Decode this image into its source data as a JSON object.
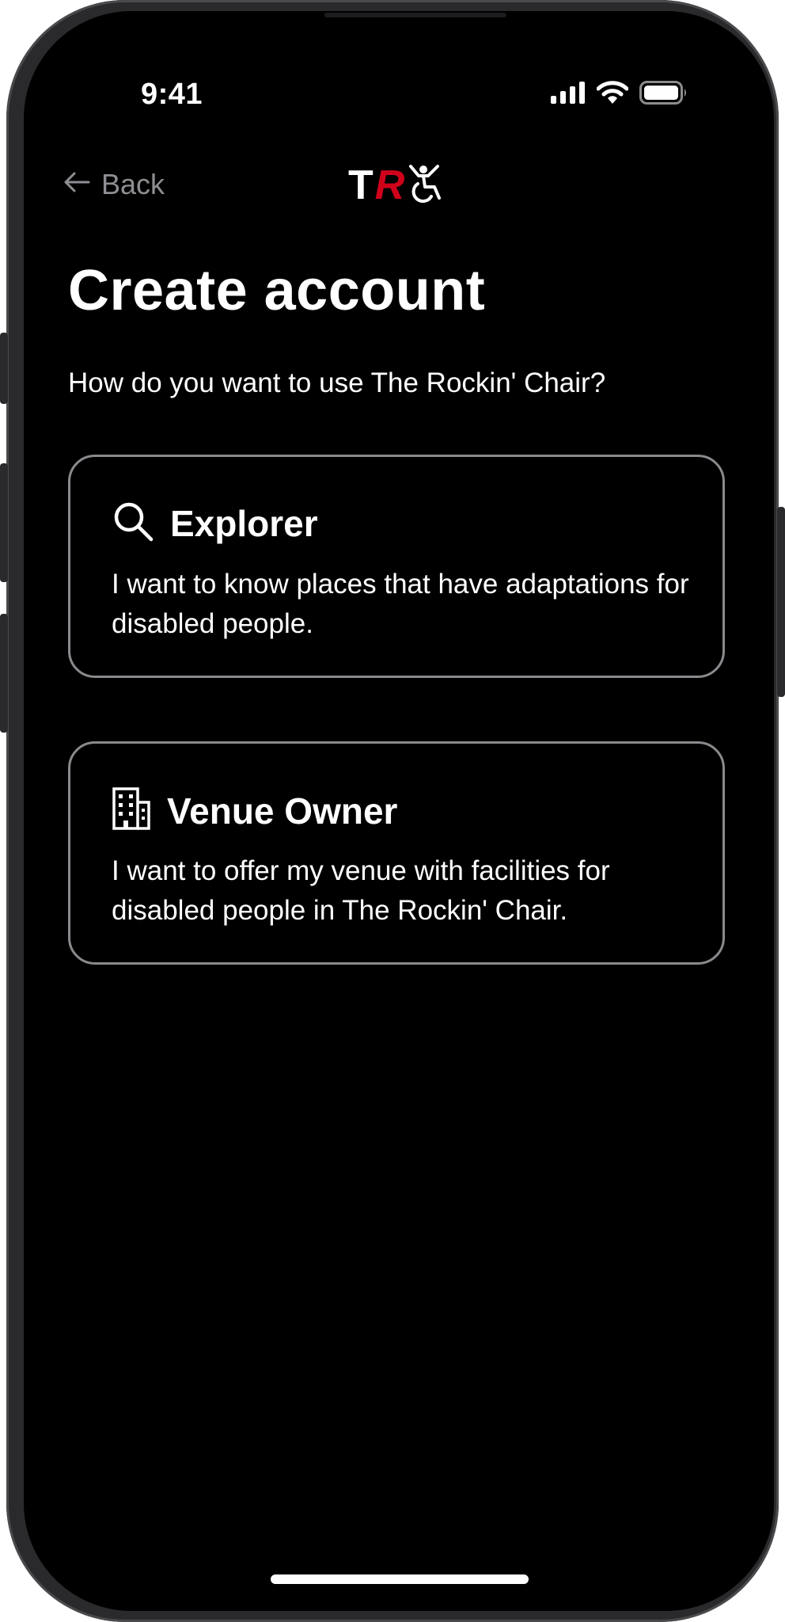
{
  "status_bar": {
    "time": "9:41",
    "icons": [
      "cellular-signal-icon",
      "wifi-icon",
      "battery-icon"
    ]
  },
  "nav": {
    "back_label": "Back",
    "back_icon": "arrow-left-icon"
  },
  "logo": {
    "text_t": "T",
    "text_r": "R",
    "icon": "wheelchair-person-icon",
    "accent_color": "#d0021b"
  },
  "page": {
    "title": "Create account",
    "subtitle": "How do you want to use The Rockin' Chair?"
  },
  "options": [
    {
      "icon": "search-icon",
      "title": "Explorer",
      "description": "I want to know places that have adaptations for disabled people."
    },
    {
      "icon": "building-icon",
      "title": "Venue Owner",
      "description": "I want to offer my venue with facilities for disabled people in The Rockin' Chair."
    }
  ],
  "colors": {
    "background": "#000000",
    "text": "#ffffff",
    "muted": "#8e8e93",
    "card_border": "#8a8a8e"
  }
}
